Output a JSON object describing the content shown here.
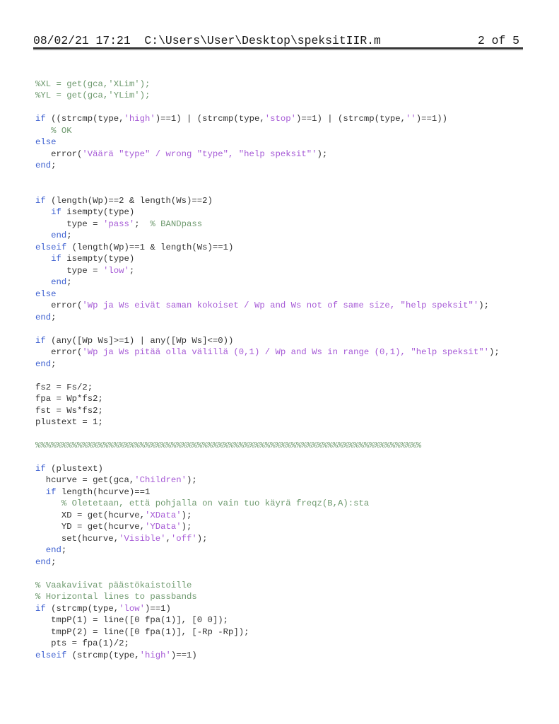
{
  "header": {
    "timestamp": "08/02/21 17:21",
    "file_path": "C:\\Users\\User\\Desktop\\speksitIIR.m",
    "page_indicator": "2 of 5"
  },
  "colors": {
    "keyword": "#3c5fd0",
    "string": "#a65ad6",
    "comment": "#6f9a6f",
    "text": "#333333"
  },
  "code_lines": [
    [
      {
        "t": "cm",
        "v": "%XL = get(gca,'XLim');"
      }
    ],
    [
      {
        "t": "cm",
        "v": "%YL = get(gca,'YLim');"
      }
    ],
    [],
    [
      {
        "t": "kw",
        "v": "if"
      },
      {
        "t": "tx",
        "v": " ((strcmp(type,"
      },
      {
        "t": "str",
        "v": "'high'"
      },
      {
        "t": "tx",
        "v": ")==1) | (strcmp(type,"
      },
      {
        "t": "str",
        "v": "'stop'"
      },
      {
        "t": "tx",
        "v": ")==1) | (strcmp(type,"
      },
      {
        "t": "str",
        "v": "''"
      },
      {
        "t": "tx",
        "v": ")==1))"
      }
    ],
    [
      {
        "t": "tx",
        "v": "   "
      },
      {
        "t": "cm",
        "v": "% OK"
      }
    ],
    [
      {
        "t": "kw",
        "v": "else"
      }
    ],
    [
      {
        "t": "tx",
        "v": "   error("
      },
      {
        "t": "str",
        "v": "'Väärä \"type\" / wrong \"type\", \"help speksit\"'"
      },
      {
        "t": "tx",
        "v": ");"
      }
    ],
    [
      {
        "t": "kw",
        "v": "end"
      },
      {
        "t": "tx",
        "v": ";"
      }
    ],
    [],
    [],
    [
      {
        "t": "kw",
        "v": "if"
      },
      {
        "t": "tx",
        "v": " (length(Wp)==2 & length(Ws)==2)"
      }
    ],
    [
      {
        "t": "tx",
        "v": "   "
      },
      {
        "t": "kw",
        "v": "if"
      },
      {
        "t": "tx",
        "v": " isempty(type)"
      }
    ],
    [
      {
        "t": "tx",
        "v": "      type = "
      },
      {
        "t": "str",
        "v": "'pass'"
      },
      {
        "t": "tx",
        "v": ";  "
      },
      {
        "t": "cm",
        "v": "% BANDpass"
      }
    ],
    [
      {
        "t": "tx",
        "v": "   "
      },
      {
        "t": "kw",
        "v": "end"
      },
      {
        "t": "tx",
        "v": ";"
      }
    ],
    [
      {
        "t": "kw",
        "v": "elseif"
      },
      {
        "t": "tx",
        "v": " (length(Wp)==1 & length(Ws)==1)"
      }
    ],
    [
      {
        "t": "tx",
        "v": "   "
      },
      {
        "t": "kw",
        "v": "if"
      },
      {
        "t": "tx",
        "v": " isempty(type)"
      }
    ],
    [
      {
        "t": "tx",
        "v": "      type = "
      },
      {
        "t": "str",
        "v": "'low'"
      },
      {
        "t": "tx",
        "v": ";"
      }
    ],
    [
      {
        "t": "tx",
        "v": "   "
      },
      {
        "t": "kw",
        "v": "end"
      },
      {
        "t": "tx",
        "v": ";"
      }
    ],
    [
      {
        "t": "kw",
        "v": "else"
      }
    ],
    [
      {
        "t": "tx",
        "v": "   error("
      },
      {
        "t": "str",
        "v": "'Wp ja Ws eivät saman kokoiset / Wp and Ws not of same size, \"help speksit\"'"
      },
      {
        "t": "tx",
        "v": ");"
      }
    ],
    [
      {
        "t": "kw",
        "v": "end"
      },
      {
        "t": "tx",
        "v": ";"
      }
    ],
    [],
    [
      {
        "t": "kw",
        "v": "if"
      },
      {
        "t": "tx",
        "v": " (any([Wp Ws]>=1) | any([Wp Ws]<=0))"
      }
    ],
    [
      {
        "t": "tx",
        "v": "   error("
      },
      {
        "t": "str",
        "v": "'Wp ja Ws pitää olla välillä (0,1) / Wp and Ws in range (0,1), \"help speksit\"'"
      },
      {
        "t": "tx",
        "v": ");"
      }
    ],
    [
      {
        "t": "kw",
        "v": "end"
      },
      {
        "t": "tx",
        "v": ";"
      }
    ],
    [],
    [
      {
        "t": "tx",
        "v": "fs2 = Fs/2;"
      }
    ],
    [
      {
        "t": "tx",
        "v": "fpa = Wp*fs2;"
      }
    ],
    [
      {
        "t": "tx",
        "v": "fst = Ws*fs2;"
      }
    ],
    [
      {
        "t": "tx",
        "v": "plustext = 1;"
      }
    ],
    [],
    [
      {
        "t": "cm",
        "v": "%%%%%%%%%%%%%%%%%%%%%%%%%%%%%%%%%%%%%%%%%%%%%%%%%%%%%%%%%%%%%%%%%%%%%%%%%%"
      }
    ],
    [],
    [
      {
        "t": "kw",
        "v": "if"
      },
      {
        "t": "tx",
        "v": " (plustext)"
      }
    ],
    [
      {
        "t": "tx",
        "v": "  hcurve = get(gca,"
      },
      {
        "t": "str",
        "v": "'Children'"
      },
      {
        "t": "tx",
        "v": ");"
      }
    ],
    [
      {
        "t": "tx",
        "v": "  "
      },
      {
        "t": "kw",
        "v": "if"
      },
      {
        "t": "tx",
        "v": " length(hcurve)==1"
      }
    ],
    [
      {
        "t": "tx",
        "v": "     "
      },
      {
        "t": "cm",
        "v": "% Oletetaan, että pohjalla on vain tuo käyrä freqz(B,A):sta"
      }
    ],
    [
      {
        "t": "tx",
        "v": "     XD = get(hcurve,"
      },
      {
        "t": "str",
        "v": "'XData'"
      },
      {
        "t": "tx",
        "v": ");"
      }
    ],
    [
      {
        "t": "tx",
        "v": "     YD = get(hcurve,"
      },
      {
        "t": "str",
        "v": "'YData'"
      },
      {
        "t": "tx",
        "v": ");"
      }
    ],
    [
      {
        "t": "tx",
        "v": "     set(hcurve,"
      },
      {
        "t": "str",
        "v": "'Visible'"
      },
      {
        "t": "tx",
        "v": ","
      },
      {
        "t": "str",
        "v": "'off'"
      },
      {
        "t": "tx",
        "v": ");"
      }
    ],
    [
      {
        "t": "tx",
        "v": "  "
      },
      {
        "t": "kw",
        "v": "end"
      },
      {
        "t": "tx",
        "v": ";"
      }
    ],
    [
      {
        "t": "kw",
        "v": "end"
      },
      {
        "t": "tx",
        "v": ";"
      }
    ],
    [],
    [
      {
        "t": "cm",
        "v": "% Vaakaviivat päästökaistoille"
      }
    ],
    [
      {
        "t": "cm",
        "v": "% Horizontal lines to passbands"
      }
    ],
    [
      {
        "t": "kw",
        "v": "if"
      },
      {
        "t": "tx",
        "v": " (strcmp(type,"
      },
      {
        "t": "str",
        "v": "'low'"
      },
      {
        "t": "tx",
        "v": ")==1)"
      }
    ],
    [
      {
        "t": "tx",
        "v": "   tmpP(1) = line([0 fpa(1)], [0 0]);"
      }
    ],
    [
      {
        "t": "tx",
        "v": "   tmpP(2) = line([0 fpa(1)], [-Rp -Rp]);"
      }
    ],
    [
      {
        "t": "tx",
        "v": "   pts = fpa(1)/2;"
      }
    ],
    [
      {
        "t": "kw",
        "v": "elseif"
      },
      {
        "t": "tx",
        "v": " (strcmp(type,"
      },
      {
        "t": "str",
        "v": "'high'"
      },
      {
        "t": "tx",
        "v": ")==1)"
      }
    ]
  ]
}
